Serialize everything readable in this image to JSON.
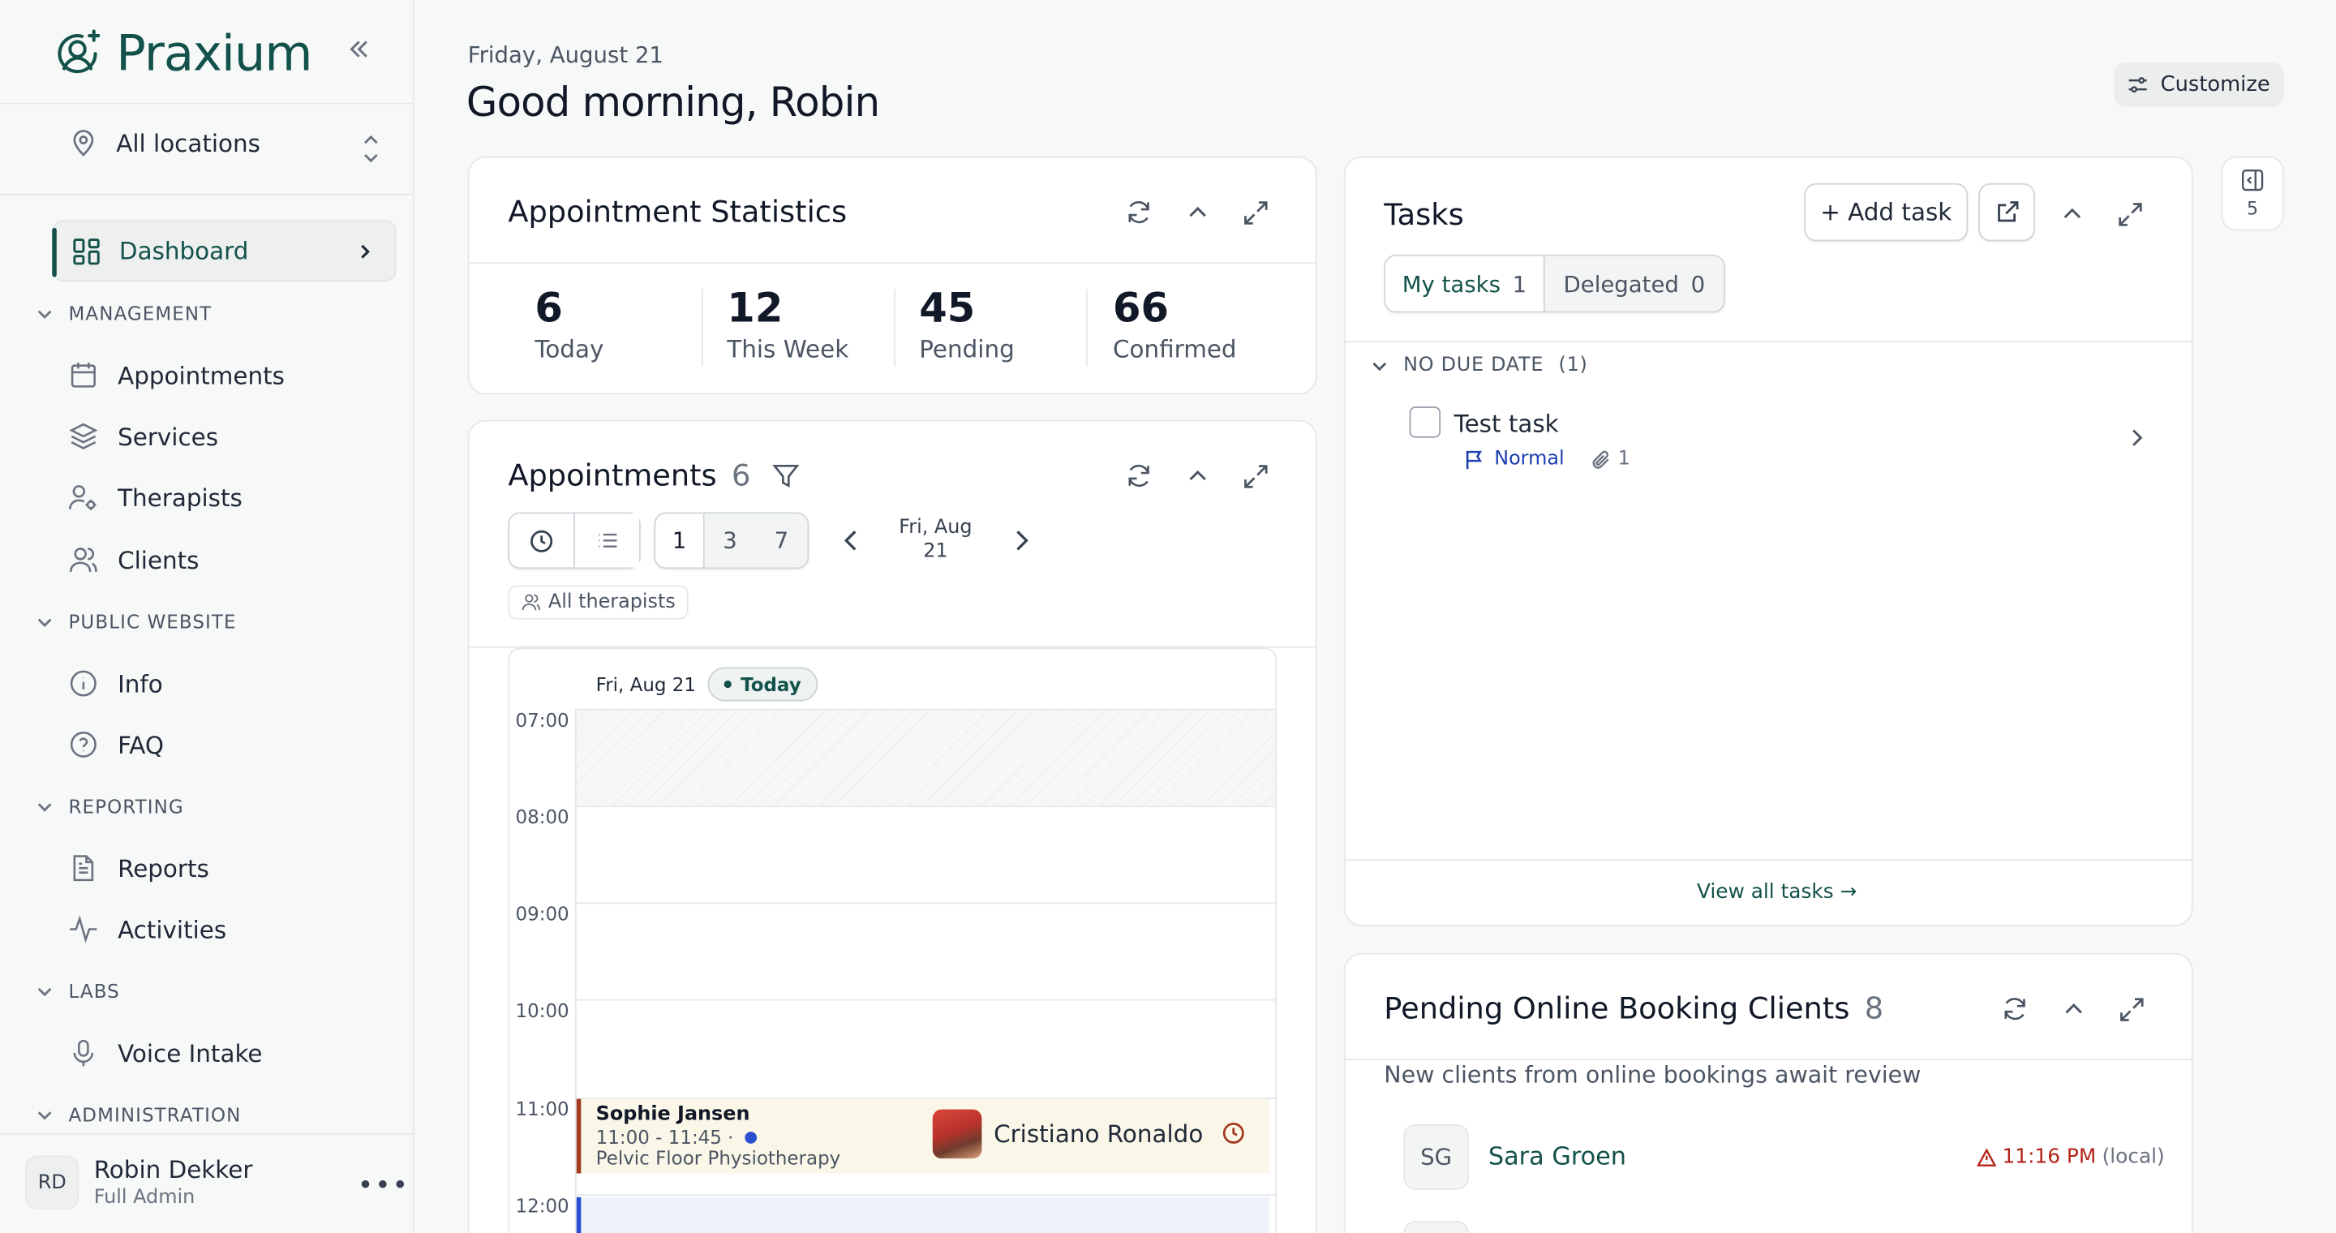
{
  "app": {
    "brand": "Praxium"
  },
  "sidebar": {
    "location": "All locations",
    "dashboard": "Dashboard",
    "sections": {
      "management": "MANAGEMENT",
      "public_website": "PUBLIC WEBSITE",
      "reporting": "REPORTING",
      "labs": "LABS",
      "administration": "ADMINISTRATION"
    },
    "items": {
      "appointments": "Appointments",
      "services": "Services",
      "therapists": "Therapists",
      "clients": "Clients",
      "info": "Info",
      "faq": "FAQ",
      "reports": "Reports",
      "activities": "Activities",
      "voice_intake": "Voice Intake"
    },
    "user": {
      "initials": "RD",
      "name": "Robin Dekker",
      "role": "Full Admin"
    }
  },
  "header": {
    "date": "Friday, August 21",
    "greeting": "Good morning, Robin",
    "customize": "Customize"
  },
  "stats": {
    "title": "Appointment Statistics",
    "items": [
      {
        "value": "6",
        "label": "Today"
      },
      {
        "value": "12",
        "label": "This Week"
      },
      {
        "value": "45",
        "label": "Pending"
      },
      {
        "value": "66",
        "label": "Confirmed"
      }
    ]
  },
  "appointments": {
    "title": "Appointments",
    "count": "6",
    "day_options": [
      "1",
      "3",
      "7"
    ],
    "nav_date_line1": "Fri, Aug",
    "nav_date_line2": "21",
    "therapist_filter": "All therapists",
    "calendar": {
      "day_label": "Fri, Aug 21",
      "today": "Today",
      "hours": [
        "07:00",
        "08:00",
        "09:00",
        "10:00",
        "11:00",
        "12:00"
      ]
    },
    "event": {
      "client": "Sophie Jansen",
      "time": "11:00 - 11:45 ·",
      "service": "Pelvic Floor Physiotherapy",
      "therapist": "Cristiano Ronaldo"
    }
  },
  "tasks": {
    "title": "Tasks",
    "add_task": "+ Add task",
    "tab_mine": "My tasks",
    "tab_mine_count": "1",
    "tab_delegated": "Delegated",
    "tab_delegated_count": "0",
    "group_label": "NO DUE DATE",
    "group_count": "(1)",
    "task": {
      "title": "Test task",
      "priority": "Normal",
      "attachments": "1"
    },
    "view_all": "View all tasks →"
  },
  "pending": {
    "title": "Pending Online Booking Clients",
    "count": "8",
    "subtitle": "New clients from online bookings await review",
    "client": {
      "initials": "SG",
      "name": "Sara Groen",
      "time": "11:16 PM",
      "tz": "(local)"
    }
  },
  "panel_toggle": {
    "count": "5"
  },
  "colors": {
    "brand": "#12524a",
    "accent_blue": "#2b4fd1",
    "warning": "#b42318"
  }
}
